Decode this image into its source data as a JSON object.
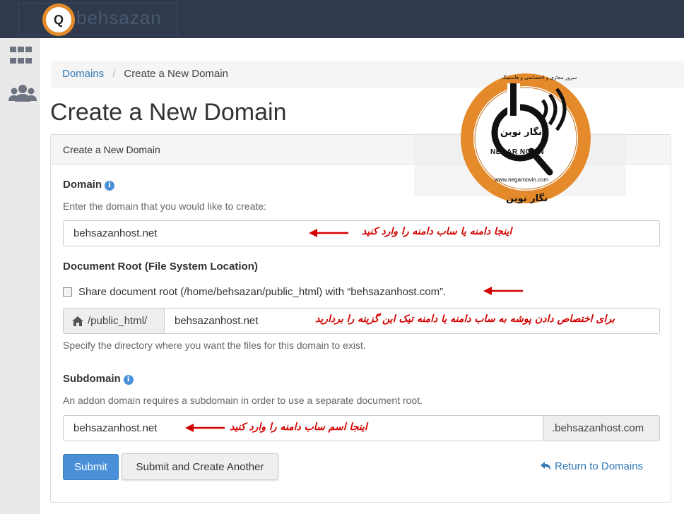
{
  "topbar": {
    "brand_text": "behsazan",
    "brand_logo_mark": "Q"
  },
  "sidebar": {
    "icons": [
      "grid-icon",
      "users-icon"
    ]
  },
  "breadcrumb": {
    "root": "Domains",
    "current": "Create a New Domain"
  },
  "page_title": "Create a New Domain",
  "panel": {
    "heading": "Create a New Domain",
    "domain": {
      "label": "Domain",
      "help": "Enter the domain that you would like to create:",
      "value": "behsazanhost.net"
    },
    "docroot": {
      "label": "Document Root (File System Location)",
      "checkbox_label": "Share document root (/home/behsazan/public_html) with “behsazanhost.com”.",
      "prefix": "/public_html/",
      "value": "behsazanhost.net",
      "help": "Specify the directory where you want the files for this domain to exist."
    },
    "subdomain": {
      "label": "Subdomain",
      "help": "An addon domain requires a subdomain in order to use a separate document root.",
      "value": "behsazanhost.net",
      "suffix": ".behsazanhost.com"
    },
    "buttons": {
      "submit": "Submit",
      "submit_another": "Submit and Create Another",
      "return": "Return to Domains"
    }
  },
  "annotations": {
    "domain": "اینجا دامنه یا ساب دامنه را وارد کنید",
    "docroot": "برای اختصاص دادن پوشه به ساب دامنه یا دامنه تیک این گزینه را بردارید",
    "subdomain": "اینجا اسم ساب دامنه را وارد کنید"
  },
  "stamp": {
    "ring_text": "سرور مجازی و اختصاصی و هاستینگ",
    "name_fa": "نگار نوین",
    "name_en": "NEGAR NOVIN",
    "url": "www.negarnovin.com",
    "bottom_fa": "نگار نوین"
  },
  "colors": {
    "topbar": "#2f3b4c",
    "primary": "#4a90d9",
    "annotation": "#d40000",
    "stamp_ring": "#e48a2a"
  }
}
